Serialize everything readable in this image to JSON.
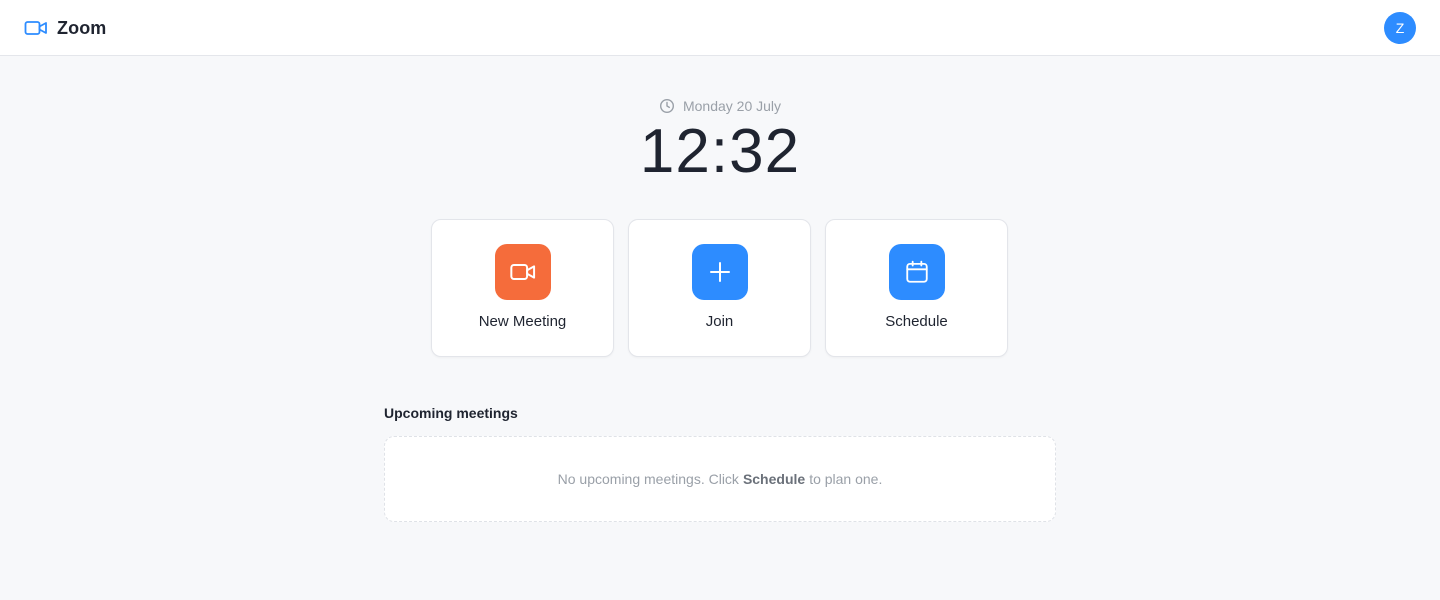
{
  "app": {
    "name": "Zoom",
    "brand_color": "#2d8cff"
  },
  "user": {
    "avatar_initial": "Z"
  },
  "clock": {
    "date": "Monday 20 July",
    "time": "12:32"
  },
  "actions": [
    {
      "label": "New Meeting",
      "icon": "video-camera-icon",
      "color": "#f56c3b"
    },
    {
      "label": "Join",
      "icon": "plus-icon",
      "color": "#2d8cff"
    },
    {
      "label": "Schedule",
      "icon": "calendar-icon",
      "color": "#2d8cff"
    }
  ],
  "upcoming": {
    "title": "Upcoming meetings",
    "empty_prefix": "No upcoming meetings. Click",
    "empty_link": "Schedule",
    "empty_suffix": "to plan one."
  }
}
